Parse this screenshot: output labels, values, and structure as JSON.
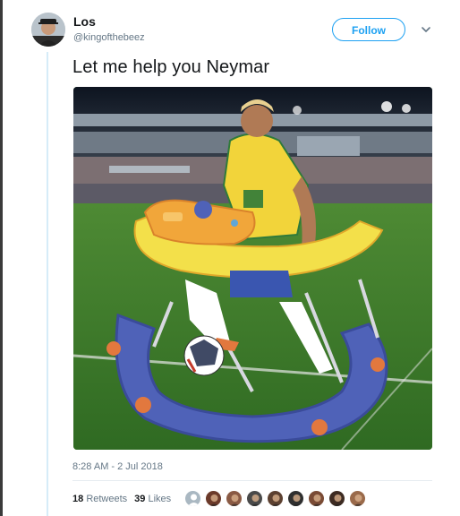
{
  "user": {
    "display_name": "Los",
    "handle": "@kingofthebeez",
    "avatar_icon": "user-avatar"
  },
  "follow": {
    "label": "Follow"
  },
  "menu": {
    "icon": "chevron-down-icon"
  },
  "tweet": {
    "text": "Let me help you Neymar",
    "media_icon": "photo-neymar-baby-walker",
    "timestamp": "8:28 AM - 2 Jul 2018"
  },
  "stats": {
    "retweets_count": "18",
    "retweets_label": "Retweets",
    "likes_count": "39",
    "likes_label": "Likes"
  },
  "likers": [
    {
      "icon": "default-avatar-icon",
      "color": "#aab8c2"
    },
    {
      "icon": "user-avatar",
      "color": "#6b3a2a"
    },
    {
      "icon": "user-avatar",
      "color": "#8a5a44"
    },
    {
      "icon": "user-avatar",
      "color": "#4a4a4a"
    },
    {
      "icon": "user-avatar",
      "color": "#5c4030"
    },
    {
      "icon": "user-avatar",
      "color": "#2f2f2f"
    },
    {
      "icon": "user-avatar",
      "color": "#7a4b35"
    },
    {
      "icon": "user-avatar",
      "color": "#3d2b22"
    },
    {
      "icon": "user-avatar",
      "color": "#9a6a4a"
    }
  ],
  "colors": {
    "brand": "#1da1f2",
    "text": "#14171a",
    "muted": "#657786"
  }
}
